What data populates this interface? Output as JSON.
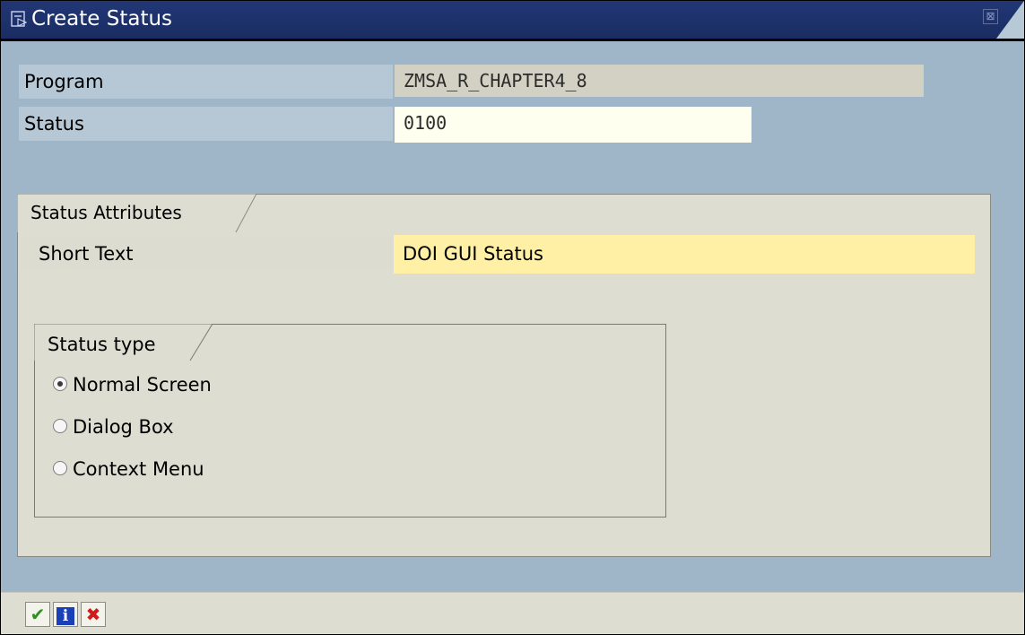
{
  "window": {
    "title": "Create Status",
    "title_icon": "window-icon",
    "close_glyph": "⊠"
  },
  "header": {
    "program": {
      "label": "Program",
      "value": "ZMSA_R_CHAPTER4_8"
    },
    "status": {
      "label": "Status",
      "value": "0100"
    }
  },
  "attributes": {
    "tab_label": "Status Attributes",
    "short_text": {
      "label": "Short Text",
      "value": "DOI GUI Status"
    },
    "status_type": {
      "tab_label": "Status type",
      "options": [
        {
          "label": "Normal Screen",
          "selected": true
        },
        {
          "label": "Dialog Box",
          "selected": false
        },
        {
          "label": "Context Menu",
          "selected": false
        }
      ]
    }
  },
  "toolbar": {
    "buttons": [
      {
        "icon": "check-icon",
        "glyph": "✔"
      },
      {
        "icon": "info-icon",
        "glyph": "i"
      },
      {
        "icon": "cancel-icon",
        "glyph": "✖"
      }
    ]
  },
  "colors": {
    "titlebar": "#213775",
    "background": "#9eb6c8",
    "label_bg": "#b6c8d5",
    "readonly_field": "#d3d1c3",
    "input_field": "#fffff0",
    "required_field": "#fff0a5",
    "frame_bg": "#ddddd2",
    "check": "#2f8f1f",
    "info": "#1a3fb6",
    "cancel": "#d21919"
  }
}
